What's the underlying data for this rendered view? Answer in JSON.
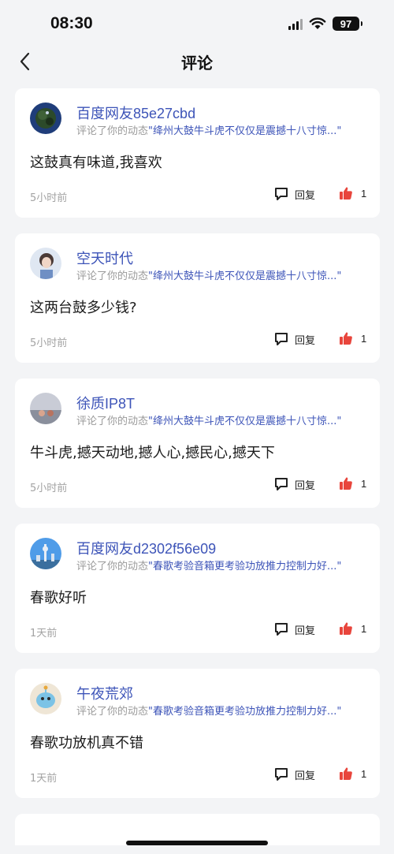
{
  "status_bar": {
    "time": "08:30",
    "battery": "97"
  },
  "nav": {
    "title": "评论"
  },
  "comments": [
    {
      "username": "百度网友85e27cbd",
      "ref_prefix": "评论了你的动态",
      "ref_title": "\"绛州大鼓牛斗虎不仅仅是震撼十八寸惊...\"",
      "text": "这鼓真有味道,我喜欢",
      "time": "5小时前",
      "reply_label": "回复",
      "likes": "1"
    },
    {
      "username": "空天时代",
      "ref_prefix": "评论了你的动态",
      "ref_title": "\"绛州大鼓牛斗虎不仅仅是震撼十八寸惊...\"",
      "text": "这两台鼓多少钱?",
      "time": "5小时前",
      "reply_label": "回复",
      "likes": "1"
    },
    {
      "username": "徐质IP8T",
      "ref_prefix": "评论了你的动态",
      "ref_title": "\"绛州大鼓牛斗虎不仅仅是震撼十八寸惊...\"",
      "text": "牛斗虎,撼天动地,撼人心,撼民心,撼天下",
      "time": "5小时前",
      "reply_label": "回复",
      "likes": "1"
    },
    {
      "username": "百度网友d2302f56e09",
      "ref_prefix": "评论了你的动态",
      "ref_title": "\"春歌考验音箱更考验功放推力控制力好...\"",
      "text": "春歌好听",
      "time": "1天前",
      "reply_label": "回复",
      "likes": "1"
    },
    {
      "username": "午夜荒郊",
      "ref_prefix": "评论了你的动态",
      "ref_title": "\"春歌考验音箱更考验功放推力控制力好...\"",
      "text": "春歌功放机真不错",
      "time": "1天前",
      "reply_label": "回复",
      "likes": "1"
    }
  ],
  "colors": {
    "accent": "#3d54b8",
    "like": "#e8453c",
    "background": "#f3f4f6"
  }
}
